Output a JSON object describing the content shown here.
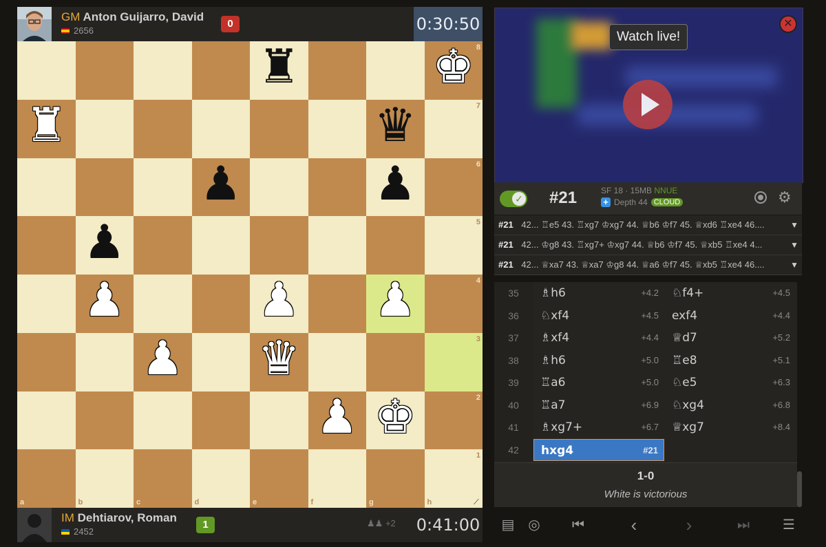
{
  "top_player": {
    "title": "GM",
    "name": "Anton Guijarro, David",
    "rating": "2656",
    "score": "0",
    "clock": "0:30:50"
  },
  "bottom_player": {
    "title": "IM",
    "name": "Dehtiarov, Roman",
    "rating": "2452",
    "score": "1",
    "spectators": "+2",
    "clock": "0:41:00"
  },
  "board": {
    "files": [
      "a",
      "b",
      "c",
      "d",
      "e",
      "f",
      "g",
      "h"
    ],
    "ranks": [
      "8",
      "7",
      "6",
      "5",
      "4",
      "3",
      "2",
      "1"
    ],
    "pieces": [
      {
        "square": "e8",
        "piece": "rook",
        "color": "black",
        "glyph": "♜"
      },
      {
        "square": "h8",
        "piece": "king",
        "color": "white",
        "glyph": "♚"
      },
      {
        "square": "a7",
        "piece": "rook",
        "color": "white",
        "glyph": "♜"
      },
      {
        "square": "g7",
        "piece": "queen",
        "color": "black",
        "glyph": "♛"
      },
      {
        "square": "d6",
        "piece": "pawn",
        "color": "black",
        "glyph": "♟"
      },
      {
        "square": "g6",
        "piece": "pawn",
        "color": "black",
        "glyph": "♟"
      },
      {
        "square": "b5",
        "piece": "pawn",
        "color": "black",
        "glyph": "♟"
      },
      {
        "square": "b4",
        "piece": "pawn",
        "color": "white",
        "glyph": "♟"
      },
      {
        "square": "e4",
        "piece": "pawn",
        "color": "white",
        "glyph": "♟"
      },
      {
        "square": "g4",
        "piece": "pawn",
        "color": "white",
        "glyph": "♟"
      },
      {
        "square": "c3",
        "piece": "pawn",
        "color": "white",
        "glyph": "♟"
      },
      {
        "square": "e3",
        "piece": "queen",
        "color": "white",
        "glyph": "♛"
      },
      {
        "square": "f2",
        "piece": "pawn",
        "color": "white",
        "glyph": "♟"
      },
      {
        "square": "g2",
        "piece": "king",
        "color": "white",
        "glyph": "♚"
      }
    ],
    "last_move": [
      "h3",
      "g4"
    ]
  },
  "video": {
    "watch_live_label": "Watch live!",
    "close_label": "✕"
  },
  "engine": {
    "eval": "#21",
    "name": "SF 18 · 15MB",
    "nnue": "NNUE",
    "depth": "Depth 44",
    "cloud": "CLOUD"
  },
  "pv_lines": [
    {
      "eval": "#21",
      "line": "42... ♖e5 43. ♖xg7 ♔xg7 44. ♕b6 ♔f7 45. ♕xd6 ♖xe4 46...."
    },
    {
      "eval": "#21",
      "line": "42... ♔g8 43. ♖xg7+ ♔xg7 44. ♕b6 ♔f7 45. ♕xb5 ♖xe4 4..."
    },
    {
      "eval": "#21",
      "line": "42... ♕xa7 43. ♕xa7 ♔g8 44. ♕a6 ♔f7 45. ♕xb5 ♖xe4 46...."
    }
  ],
  "moves": [
    {
      "num": "35",
      "white": "♗h6",
      "white_eval": "+4.2",
      "black": "♘f4+",
      "black_eval": "+4.5"
    },
    {
      "num": "36",
      "white": "♘xf4",
      "white_eval": "+4.5",
      "black": "exf4",
      "black_eval": "+4.4"
    },
    {
      "num": "37",
      "white": "♗xf4",
      "white_eval": "+4.4",
      "black": "♕d7",
      "black_eval": "+5.2"
    },
    {
      "num": "38",
      "white": "♗h6",
      "white_eval": "+5.0",
      "black": "♖e8",
      "black_eval": "+5.1"
    },
    {
      "num": "39",
      "white": "♖a6",
      "white_eval": "+5.0",
      "black": "♘e5",
      "black_eval": "+6.3"
    },
    {
      "num": "40",
      "white": "♖a7",
      "white_eval": "+6.9",
      "black": "♘xg4",
      "black_eval": "+6.8"
    },
    {
      "num": "41",
      "white": "♗xg7+",
      "white_eval": "+6.7",
      "black": "♕xg7",
      "black_eval": "+8.4"
    },
    {
      "num": "42",
      "white": "hxg4",
      "white_eval": "#21",
      "black": "",
      "black_eval": ""
    }
  ],
  "result": {
    "score": "1-0",
    "status": "White is victorious"
  },
  "controls": {
    "book_icon": "book-icon",
    "target_icon": "target-icon",
    "first_icon": "first-icon",
    "prev_icon": "prev-icon",
    "next_icon": "next-icon",
    "last_icon": "last-icon",
    "menu_icon": "menu-icon"
  }
}
